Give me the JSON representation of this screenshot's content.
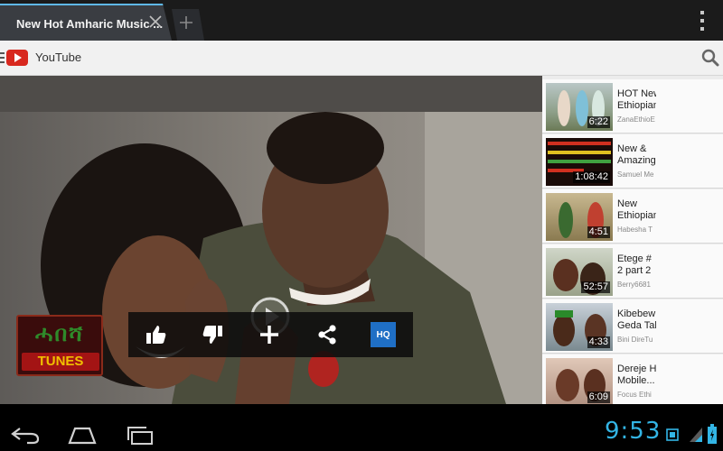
{
  "browser": {
    "tab_title": "New Hot Amharic Music ...",
    "close_icon": "close-icon",
    "new_tab_icon": "plus-icon",
    "menu_icon": "overflow-menu-icon"
  },
  "youtube": {
    "title": "YouTube",
    "search_icon": "search-icon",
    "menu_icon": "menu-icon"
  },
  "player": {
    "play_icon": "play-icon",
    "channel_logo": {
      "top": "ሓበሻ",
      "bottom": "TUNES"
    },
    "controls": {
      "like_icon": "thumbs-up-icon",
      "dislike_icon": "thumbs-down-icon",
      "add_icon": "plus-icon",
      "share_icon": "share-icon",
      "hq_label": "HQ"
    }
  },
  "related": [
    {
      "title": [
        "HOT New",
        "Ethiopian"
      ],
      "author": "ZanaEthioE",
      "duration": "6:22"
    },
    {
      "title": [
        "New &",
        "Amazing."
      ],
      "author": "Samuel Me",
      "duration": "1:08:42"
    },
    {
      "title": [
        "New",
        "Ethiopian"
      ],
      "author": "Habesha T",
      "duration": "4:51"
    },
    {
      "title": [
        "Etege #",
        "2 part 2"
      ],
      "author": "Berry6681",
      "duration": "52:57"
    },
    {
      "title": [
        "Kibebew",
        "Geda Tall"
      ],
      "author": "Bini DireTu",
      "duration": "4:33"
    },
    {
      "title": [
        "Dereje Ha",
        "Mobile..."
      ],
      "author": "Focus Ethi",
      "duration": "6:09"
    }
  ],
  "system": {
    "clock": "9:53",
    "back_icon": "back-icon",
    "home_icon": "home-icon",
    "recents_icon": "recents-icon"
  },
  "colors": {
    "accent": "#33b5e5",
    "youtube_red": "#d8281e",
    "hq_blue": "#1f6fc5"
  }
}
